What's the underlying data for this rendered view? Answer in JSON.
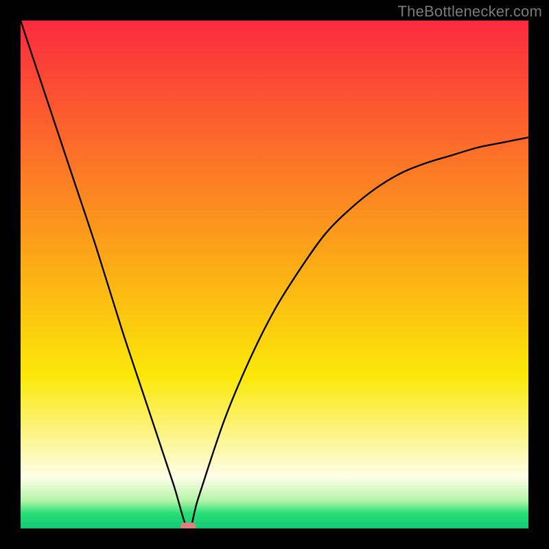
{
  "attribution": "TheBottlenecker.com",
  "chart_data": {
    "type": "line",
    "title": "",
    "xlabel": "",
    "ylabel": "",
    "xlim": [
      0,
      100
    ],
    "ylim": [
      0,
      100
    ],
    "x_of_min": 33,
    "series": [
      {
        "name": "curve",
        "x": [
          0,
          5,
          10,
          15,
          20,
          25,
          30,
          33,
          35,
          40,
          45,
          50,
          55,
          60,
          65,
          70,
          75,
          80,
          85,
          90,
          95,
          100
        ],
        "y": [
          100,
          85,
          70,
          55,
          39,
          24,
          9,
          0,
          6,
          21,
          33,
          43,
          51,
          58,
          63,
          67,
          70,
          72,
          73.5,
          75,
          76,
          77
        ]
      }
    ],
    "marker": {
      "x": 33,
      "y": 0
    },
    "gradient_stops": [
      {
        "pct": 0,
        "color": "#fb2a3e"
      },
      {
        "pct": 45,
        "color": "#fca319"
      },
      {
        "pct": 70,
        "color": "#fbe808"
      },
      {
        "pct": 82,
        "color": "#fcf58e"
      },
      {
        "pct": 90,
        "color": "#fefee8"
      },
      {
        "pct": 94.5,
        "color": "#b6f4a8"
      },
      {
        "pct": 97,
        "color": "#29df76"
      },
      {
        "pct": 100,
        "color": "#13c876"
      }
    ],
    "marker_color": "#e17f7b",
    "curve_color": "#000000"
  }
}
